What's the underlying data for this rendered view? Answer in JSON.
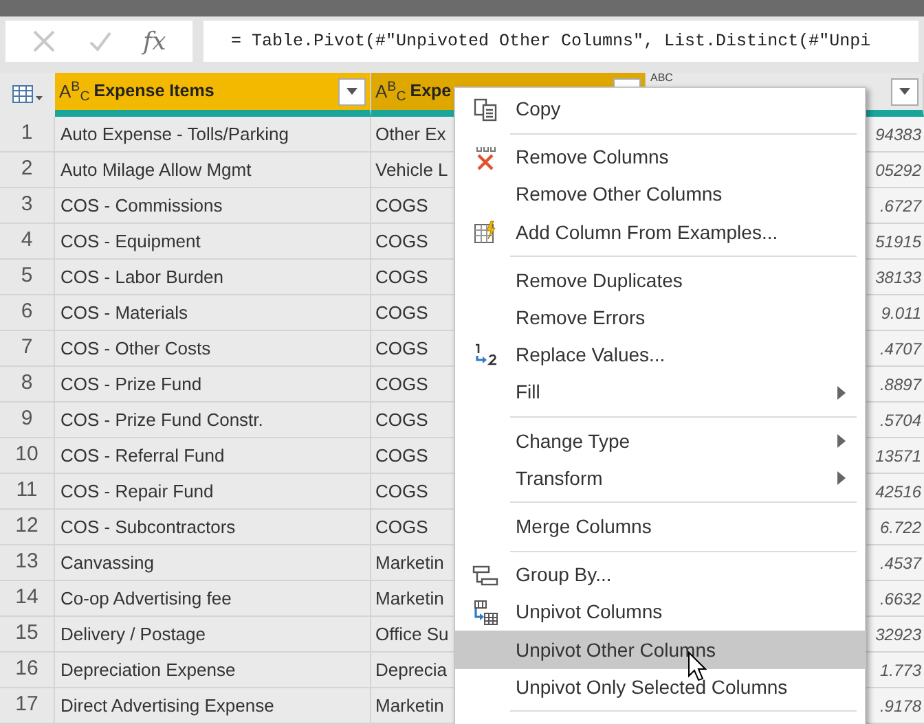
{
  "formula_bar": {
    "fx": "fx",
    "formula": "= Table.Pivot(#\"Unpivoted Other Columns\", List.Distinct(#\"Unpi"
  },
  "table": {
    "columns": [
      {
        "type_label": "A$^{B}$$_{C}$",
        "title": "Expense Items",
        "selected": true,
        "hovered": false
      },
      {
        "type_label": "A$^{B}$$_{C}$",
        "title": "Expe",
        "selected": true,
        "hovered": true
      },
      {
        "type_label": "ABC",
        "selected": false,
        "hovered": false
      }
    ],
    "rows": [
      {
        "n": "1",
        "item": "Auto Expense - Tolls/Parking",
        "category": "Other Ex",
        "value": "94383"
      },
      {
        "n": "2",
        "item": "Auto Milage Allow Mgmt",
        "category": "Vehicle L",
        "value": "05292"
      },
      {
        "n": "3",
        "item": "COS - Commissions",
        "category": "COGS",
        "value": ".6727"
      },
      {
        "n": "4",
        "item": "COS - Equipment",
        "category": "COGS",
        "value": "51915"
      },
      {
        "n": "5",
        "item": "COS - Labor Burden",
        "category": "COGS",
        "value": "38133"
      },
      {
        "n": "6",
        "item": "COS - Materials",
        "category": "COGS",
        "value": "9.011"
      },
      {
        "n": "7",
        "item": "COS - Other Costs",
        "category": "COGS",
        "value": ".4707"
      },
      {
        "n": "8",
        "item": "COS - Prize Fund",
        "category": "COGS",
        "value": ".8897"
      },
      {
        "n": "9",
        "item": "COS - Prize Fund Constr.",
        "category": "COGS",
        "value": ".5704"
      },
      {
        "n": "10",
        "item": "COS - Referral Fund",
        "category": "COGS",
        "value": "13571"
      },
      {
        "n": "11",
        "item": "COS - Repair Fund",
        "category": "COGS",
        "value": "42516"
      },
      {
        "n": "12",
        "item": "COS - Subcontractors",
        "category": "COGS",
        "value": "6.722"
      },
      {
        "n": "13",
        "item": "Canvassing",
        "category": "Marketin",
        "value": ".4537"
      },
      {
        "n": "14",
        "item": "Co-op Advertising fee",
        "category": "Marketin",
        "value": ".6632"
      },
      {
        "n": "15",
        "item": "Delivery / Postage",
        "category": "Office Su",
        "value": "32923"
      },
      {
        "n": "16",
        "item": "Depreciation Expense",
        "category": "Deprecia",
        "value": "1.773"
      },
      {
        "n": "17",
        "item": "Direct Advertising Expense",
        "category": "Marketin",
        "value": ".9178"
      }
    ]
  },
  "context_menu": {
    "items": [
      {
        "kind": "copy",
        "label": "Copy",
        "submenu": false,
        "selected": false
      },
      {
        "kind": "separator"
      },
      {
        "kind": "remove",
        "label": "Remove Columns",
        "submenu": false,
        "selected": false
      },
      {
        "kind": "plain",
        "label": "Remove Other Columns",
        "submenu": false,
        "selected": false
      },
      {
        "kind": "examples",
        "label": "Add Column From Examples...",
        "submenu": false,
        "selected": false
      },
      {
        "kind": "separator"
      },
      {
        "kind": "plain",
        "label": "Remove Duplicates",
        "submenu": false,
        "selected": false
      },
      {
        "kind": "plain",
        "label": "Remove Errors",
        "submenu": false,
        "selected": false
      },
      {
        "kind": "replace",
        "label": "Replace Values...",
        "submenu": false,
        "selected": false
      },
      {
        "kind": "plain",
        "label": "Fill",
        "submenu": true,
        "selected": false
      },
      {
        "kind": "separator"
      },
      {
        "kind": "plain",
        "label": "Change Type",
        "submenu": true,
        "selected": false
      },
      {
        "kind": "plain",
        "label": "Transform",
        "submenu": true,
        "selected": false
      },
      {
        "kind": "separator"
      },
      {
        "kind": "plain",
        "label": "Merge Columns",
        "submenu": false,
        "selected": false
      },
      {
        "kind": "separator"
      },
      {
        "kind": "group",
        "label": "Group By...",
        "submenu": false,
        "selected": false
      },
      {
        "kind": "unpivot",
        "label": "Unpivot Columns",
        "submenu": false,
        "selected": false
      },
      {
        "kind": "plain",
        "label": "Unpivot Other Columns",
        "submenu": false,
        "selected": true
      },
      {
        "kind": "plain",
        "label": "Unpivot Only Selected Columns",
        "submenu": false,
        "selected": false
      },
      {
        "kind": "separator"
      }
    ]
  }
}
